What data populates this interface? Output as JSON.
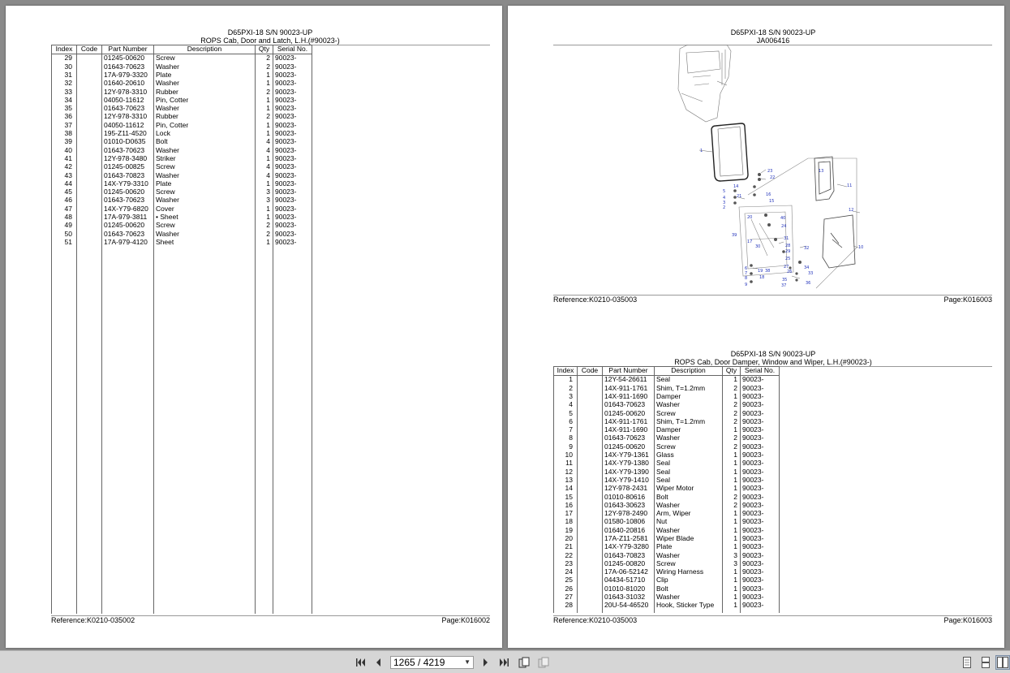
{
  "left_page": {
    "title": "D65PXI-18 S/N 90023-UP",
    "subtitle": "ROPS Cab, Door and Latch, L.H.(#90023-)",
    "columns": [
      "Index",
      "Code",
      "Part Number",
      "Description",
      "Qty",
      "Serial No."
    ],
    "rows": [
      {
        "index": "29",
        "code": "",
        "part": "01245-00620",
        "desc": "Screw",
        "qty": "2",
        "serial": "90023-"
      },
      {
        "index": "30",
        "code": "",
        "part": "01643-70623",
        "desc": "Washer",
        "qty": "2",
        "serial": "90023-"
      },
      {
        "index": "31",
        "code": "",
        "part": "17A-979-3320",
        "desc": "Plate",
        "qty": "1",
        "serial": "90023-"
      },
      {
        "index": "32",
        "code": "",
        "part": "01640-20610",
        "desc": "Washer",
        "qty": "1",
        "serial": "90023-"
      },
      {
        "index": "33",
        "code": "",
        "part": "12Y-978-3310",
        "desc": "Rubber",
        "qty": "2",
        "serial": "90023-"
      },
      {
        "index": "34",
        "code": "",
        "part": "04050-11612",
        "desc": "Pin, Cotter",
        "qty": "1",
        "serial": "90023-"
      },
      {
        "index": "35",
        "code": "",
        "part": "01643-70623",
        "desc": "Washer",
        "qty": "1",
        "serial": "90023-"
      },
      {
        "index": "36",
        "code": "",
        "part": "12Y-978-3310",
        "desc": "Rubber",
        "qty": "2",
        "serial": "90023-"
      },
      {
        "index": "37",
        "code": "",
        "part": "04050-11612",
        "desc": "Pin, Cotter",
        "qty": "1",
        "serial": "90023-"
      },
      {
        "index": "38",
        "code": "",
        "part": "195-Z11-4520",
        "desc": "Lock",
        "qty": "1",
        "serial": "90023-"
      },
      {
        "index": "39",
        "code": "",
        "part": "01010-D0635",
        "desc": "Bolt",
        "qty": "4",
        "serial": "90023-"
      },
      {
        "index": "40",
        "code": "",
        "part": "01643-70623",
        "desc": "Washer",
        "qty": "4",
        "serial": "90023-"
      },
      {
        "index": "41",
        "code": "",
        "part": "12Y-978-3480",
        "desc": "Striker",
        "qty": "1",
        "serial": "90023-"
      },
      {
        "index": "42",
        "code": "",
        "part": "01245-00825",
        "desc": "Screw",
        "qty": "4",
        "serial": "90023-"
      },
      {
        "index": "43",
        "code": "",
        "part": "01643-70823",
        "desc": "Washer",
        "qty": "4",
        "serial": "90023-"
      },
      {
        "index": "44",
        "code": "",
        "part": "14X-Y79-3310",
        "desc": "Plate",
        "qty": "1",
        "serial": "90023-"
      },
      {
        "index": "45",
        "code": "",
        "part": "01245-00620",
        "desc": "Screw",
        "qty": "3",
        "serial": "90023-"
      },
      {
        "index": "46",
        "code": "",
        "part": "01643-70623",
        "desc": "Washer",
        "qty": "3",
        "serial": "90023-"
      },
      {
        "index": "47",
        "code": "",
        "part": "14X-Y79-6820",
        "desc": "Cover",
        "qty": "1",
        "serial": "90023-"
      },
      {
        "index": "48",
        "code": "",
        "part": "17A-979-3811",
        "desc": "• Sheet",
        "qty": "1",
        "serial": "90023-"
      },
      {
        "index": "49",
        "code": "",
        "part": "01245-00620",
        "desc": "Screw",
        "qty": "2",
        "serial": "90023-"
      },
      {
        "index": "50",
        "code": "",
        "part": "01643-70623",
        "desc": "Washer",
        "qty": "2",
        "serial": "90023-"
      },
      {
        "index": "51",
        "code": "",
        "part": "17A-979-4120",
        "desc": "Sheet",
        "qty": "1",
        "serial": "90023-"
      }
    ],
    "reference": "Reference:K0210-035002",
    "page": "Page:K016002"
  },
  "right_page": {
    "diagram_title": "D65PXI-18 S/N 90023-UP",
    "diagram_subtitle": "JA006416",
    "diagram_reference": "Reference:K0210-035003",
    "diagram_page": "Page:K016003",
    "callouts": [
      "1",
      "2",
      "3",
      "4",
      "5",
      "6",
      "7",
      "8",
      "9",
      "10",
      "11",
      "12",
      "13",
      "14",
      "15",
      "16",
      "17",
      "18",
      "19",
      "20",
      "21",
      "22",
      "23",
      "24",
      "25",
      "26",
      "27",
      "28",
      "29",
      "30",
      "31",
      "32",
      "33",
      "34",
      "35",
      "36",
      "37",
      "38",
      "39",
      "40"
    ],
    "title": "D65PXI-18 S/N 90023-UP",
    "subtitle": "ROPS Cab, Door Damper, Window and Wiper, L.H.(#90023-)",
    "columns": [
      "Index",
      "Code",
      "Part Number",
      "Description",
      "Qty",
      "Serial No."
    ],
    "rows": [
      {
        "index": "1",
        "code": "",
        "part": "12Y-54-26611",
        "desc": "Seal",
        "qty": "1",
        "serial": "90023-"
      },
      {
        "index": "2",
        "code": "",
        "part": "14X-911-1761",
        "desc": "Shim, T=1.2mm",
        "qty": "2",
        "serial": "90023-"
      },
      {
        "index": "3",
        "code": "",
        "part": "14X-911-1690",
        "desc": "Damper",
        "qty": "1",
        "serial": "90023-"
      },
      {
        "index": "4",
        "code": "",
        "part": "01643-70623",
        "desc": "Washer",
        "qty": "2",
        "serial": "90023-"
      },
      {
        "index": "5",
        "code": "",
        "part": "01245-00620",
        "desc": "Screw",
        "qty": "2",
        "serial": "90023-"
      },
      {
        "index": "6",
        "code": "",
        "part": "14X-911-1761",
        "desc": "Shim, T=1.2mm",
        "qty": "2",
        "serial": "90023-"
      },
      {
        "index": "7",
        "code": "",
        "part": "14X-911-1690",
        "desc": "Damper",
        "qty": "1",
        "serial": "90023-"
      },
      {
        "index": "8",
        "code": "",
        "part": "01643-70623",
        "desc": "Washer",
        "qty": "2",
        "serial": "90023-"
      },
      {
        "index": "9",
        "code": "",
        "part": "01245-00620",
        "desc": "Screw",
        "qty": "2",
        "serial": "90023-"
      },
      {
        "index": "10",
        "code": "",
        "part": "14X-Y79-1361",
        "desc": "Glass",
        "qty": "1",
        "serial": "90023-"
      },
      {
        "index": "11",
        "code": "",
        "part": "14X-Y79-1380",
        "desc": "Seal",
        "qty": "1",
        "serial": "90023-"
      },
      {
        "index": "12",
        "code": "",
        "part": "14X-Y79-1390",
        "desc": "Seal",
        "qty": "1",
        "serial": "90023-"
      },
      {
        "index": "13",
        "code": "",
        "part": "14X-Y79-1410",
        "desc": "Seal",
        "qty": "1",
        "serial": "90023-"
      },
      {
        "index": "14",
        "code": "",
        "part": "12Y-978-2431",
        "desc": "Wiper Motor",
        "qty": "1",
        "serial": "90023-"
      },
      {
        "index": "15",
        "code": "",
        "part": "01010-80616",
        "desc": "Bolt",
        "qty": "2",
        "serial": "90023-"
      },
      {
        "index": "16",
        "code": "",
        "part": "01643-30623",
        "desc": "Washer",
        "qty": "2",
        "serial": "90023-"
      },
      {
        "index": "17",
        "code": "",
        "part": "12Y-978-2490",
        "desc": "Arm, Wiper",
        "qty": "1",
        "serial": "90023-"
      },
      {
        "index": "18",
        "code": "",
        "part": "01580-10806",
        "desc": "Nut",
        "qty": "1",
        "serial": "90023-"
      },
      {
        "index": "19",
        "code": "",
        "part": "01640-20816",
        "desc": "Washer",
        "qty": "1",
        "serial": "90023-"
      },
      {
        "index": "20",
        "code": "",
        "part": "17A-Z11-2581",
        "desc": "Wiper Blade",
        "qty": "1",
        "serial": "90023-"
      },
      {
        "index": "21",
        "code": "",
        "part": "14X-Y79-3280",
        "desc": "Plate",
        "qty": "1",
        "serial": "90023-"
      },
      {
        "index": "22",
        "code": "",
        "part": "01643-70823",
        "desc": "Washer",
        "qty": "3",
        "serial": "90023-"
      },
      {
        "index": "23",
        "code": "",
        "part": "01245-00820",
        "desc": "Screw",
        "qty": "3",
        "serial": "90023-"
      },
      {
        "index": "24",
        "code": "",
        "part": "17A-06-52142",
        "desc": "Wiring Harness",
        "qty": "1",
        "serial": "90023-"
      },
      {
        "index": "25",
        "code": "",
        "part": "04434-51710",
        "desc": "Clip",
        "qty": "1",
        "serial": "90023-"
      },
      {
        "index": "26",
        "code": "",
        "part": "01010-81020",
        "desc": "Bolt",
        "qty": "1",
        "serial": "90023-"
      },
      {
        "index": "27",
        "code": "",
        "part": "01643-31032",
        "desc": "Washer",
        "qty": "1",
        "serial": "90023-"
      },
      {
        "index": "28",
        "code": "",
        "part": "20U-54-46520",
        "desc": "Hook, Sticker Type",
        "qty": "1",
        "serial": "90023-"
      }
    ],
    "reference": "Reference:K0210-035003",
    "page": "Page:K016003"
  },
  "toolbar": {
    "page_value": "1265 / 4219",
    "icons": [
      "first-page-icon",
      "prev-page-icon",
      "next-page-icon",
      "last-page-icon",
      "rotate-icon",
      "two-page-icon",
      "single-page-view-icon",
      "continuous-view-icon",
      "facing-view-icon"
    ]
  }
}
